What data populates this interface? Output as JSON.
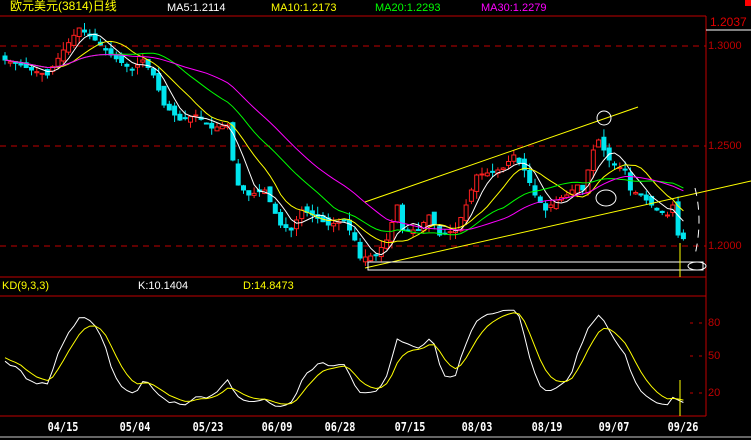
{
  "header": {
    "title": "欧元美元(3814)日线",
    "ma5": "MA5:1.2114",
    "ma10": "MA10:1.2173",
    "ma20": "MA20:1.2293",
    "ma30": "MA30:1.2279",
    "last_price": "1.2037"
  },
  "kd_header": {
    "title": "KD(9,3,3)",
    "k": "K:10.1404",
    "d": "D:14.8473"
  },
  "colors": {
    "up": "#ff2020",
    "down": "#00e5ee",
    "ma5": "#ffffff",
    "ma10": "#ffff00",
    "ma20": "#00ff00",
    "ma30": "#ff00ff",
    "grid": "#c00000"
  },
  "chart_data": [
    {
      "type": "candlestick",
      "title": "欧元美元(3814)日线",
      "ylim": [
        1.185,
        1.32
      ],
      "y_ticks": [
        "1.3000",
        "1.2500",
        "1.2000"
      ],
      "x_tick_labels": [
        "04/15",
        "05/04",
        "05/23",
        "06/09",
        "06/28",
        "07/15",
        "08/03",
        "08/19",
        "09/07",
        "09/26"
      ],
      "close_keypoints": [
        [
          0,
          1.293
        ],
        [
          3,
          1.2905
        ],
        [
          5,
          1.288
        ],
        [
          8,
          1.2855
        ],
        [
          11,
          1.298
        ],
        [
          14,
          1.309
        ],
        [
          17,
          1.303
        ],
        [
          20,
          1.2955
        ],
        [
          24,
          1.288
        ],
        [
          26,
          1.293
        ],
        [
          28,
          1.2855
        ],
        [
          30,
          1.2705
        ],
        [
          33,
          1.263
        ],
        [
          36,
          1.2655
        ],
        [
          39,
          1.259
        ],
        [
          42,
          1.2605
        ],
        [
          43,
          1.243
        ],
        [
          44,
          1.2305
        ],
        [
          46,
          1.2255
        ],
        [
          49,
          1.228
        ],
        [
          52,
          1.2105
        ],
        [
          54,
          1.208
        ],
        [
          56,
          1.218
        ],
        [
          58,
          1.2155
        ],
        [
          61,
          1.2105
        ],
        [
          64,
          1.213
        ],
        [
          66,
          1.203
        ],
        [
          67,
          1.194
        ],
        [
          70,
          1.1955
        ],
        [
          72,
          1.203
        ],
        [
          74,
          1.2205
        ],
        [
          75,
          1.208
        ],
        [
          78,
          1.208
        ],
        [
          80,
          1.2155
        ],
        [
          82,
          1.2055
        ],
        [
          85,
          1.208
        ],
        [
          87,
          1.2205
        ],
        [
          89,
          1.2355
        ],
        [
          92,
          1.237
        ],
        [
          94,
          1.239
        ],
        [
          96,
          1.2455
        ],
        [
          98,
          1.238
        ],
        [
          100,
          1.2255
        ],
        [
          102,
          1.218
        ],
        [
          104,
          1.223
        ],
        [
          106,
          1.2255
        ],
        [
          108,
          1.2305
        ],
        [
          109,
          1.228
        ],
        [
          111,
          1.248
        ],
        [
          112,
          1.253
        ],
        [
          114,
          1.243
        ],
        [
          115,
          1.2405
        ],
        [
          117,
          1.238
        ],
        [
          118,
          1.228
        ],
        [
          120,
          1.2255
        ],
        [
          123,
          1.218
        ],
        [
          125,
          1.2155
        ],
        [
          126,
          1.2205
        ],
        [
          127,
          1.2055
        ],
        [
          128,
          1.2037
        ]
      ],
      "last_close": 1.2037,
      "moving_averages": {
        "MA5": 1.2114,
        "MA10": 1.2173,
        "MA20": 1.2293,
        "MA30": 1.2279
      }
    },
    {
      "type": "line",
      "title": "KD(9,3,3)",
      "y_ticks": [
        "80",
        "50",
        "20"
      ],
      "ylim": [
        0,
        100
      ],
      "series": [
        {
          "name": "K",
          "last": 10.1404
        },
        {
          "name": "D",
          "last": 14.8473
        }
      ]
    }
  ]
}
